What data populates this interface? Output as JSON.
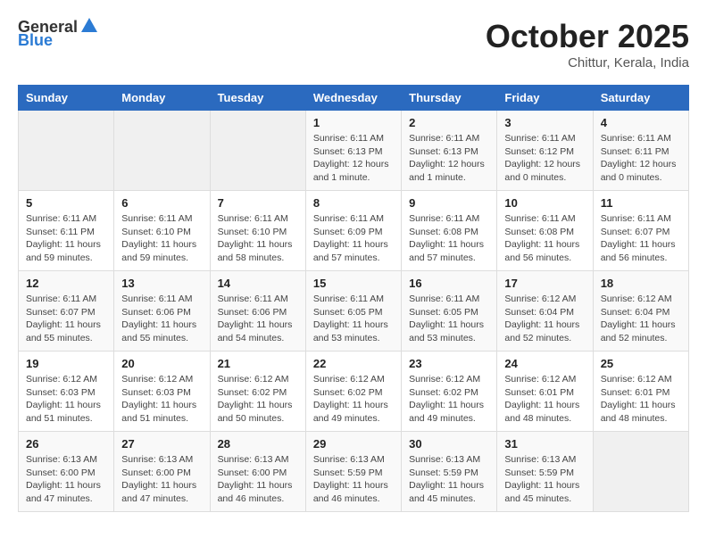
{
  "header": {
    "logo_general": "General",
    "logo_blue": "Blue",
    "month_title": "October 2025",
    "location": "Chittur, Kerala, India"
  },
  "weekdays": [
    "Sunday",
    "Monday",
    "Tuesday",
    "Wednesday",
    "Thursday",
    "Friday",
    "Saturday"
  ],
  "weeks": [
    [
      {
        "day": "",
        "info": ""
      },
      {
        "day": "",
        "info": ""
      },
      {
        "day": "",
        "info": ""
      },
      {
        "day": "1",
        "info": "Sunrise: 6:11 AM\nSunset: 6:13 PM\nDaylight: 12 hours\nand 1 minute."
      },
      {
        "day": "2",
        "info": "Sunrise: 6:11 AM\nSunset: 6:13 PM\nDaylight: 12 hours\nand 1 minute."
      },
      {
        "day": "3",
        "info": "Sunrise: 6:11 AM\nSunset: 6:12 PM\nDaylight: 12 hours\nand 0 minutes."
      },
      {
        "day": "4",
        "info": "Sunrise: 6:11 AM\nSunset: 6:11 PM\nDaylight: 12 hours\nand 0 minutes."
      }
    ],
    [
      {
        "day": "5",
        "info": "Sunrise: 6:11 AM\nSunset: 6:11 PM\nDaylight: 11 hours\nand 59 minutes."
      },
      {
        "day": "6",
        "info": "Sunrise: 6:11 AM\nSunset: 6:10 PM\nDaylight: 11 hours\nand 59 minutes."
      },
      {
        "day": "7",
        "info": "Sunrise: 6:11 AM\nSunset: 6:10 PM\nDaylight: 11 hours\nand 58 minutes."
      },
      {
        "day": "8",
        "info": "Sunrise: 6:11 AM\nSunset: 6:09 PM\nDaylight: 11 hours\nand 57 minutes."
      },
      {
        "day": "9",
        "info": "Sunrise: 6:11 AM\nSunset: 6:08 PM\nDaylight: 11 hours\nand 57 minutes."
      },
      {
        "day": "10",
        "info": "Sunrise: 6:11 AM\nSunset: 6:08 PM\nDaylight: 11 hours\nand 56 minutes."
      },
      {
        "day": "11",
        "info": "Sunrise: 6:11 AM\nSunset: 6:07 PM\nDaylight: 11 hours\nand 56 minutes."
      }
    ],
    [
      {
        "day": "12",
        "info": "Sunrise: 6:11 AM\nSunset: 6:07 PM\nDaylight: 11 hours\nand 55 minutes."
      },
      {
        "day": "13",
        "info": "Sunrise: 6:11 AM\nSunset: 6:06 PM\nDaylight: 11 hours\nand 55 minutes."
      },
      {
        "day": "14",
        "info": "Sunrise: 6:11 AM\nSunset: 6:06 PM\nDaylight: 11 hours\nand 54 minutes."
      },
      {
        "day": "15",
        "info": "Sunrise: 6:11 AM\nSunset: 6:05 PM\nDaylight: 11 hours\nand 53 minutes."
      },
      {
        "day": "16",
        "info": "Sunrise: 6:11 AM\nSunset: 6:05 PM\nDaylight: 11 hours\nand 53 minutes."
      },
      {
        "day": "17",
        "info": "Sunrise: 6:12 AM\nSunset: 6:04 PM\nDaylight: 11 hours\nand 52 minutes."
      },
      {
        "day": "18",
        "info": "Sunrise: 6:12 AM\nSunset: 6:04 PM\nDaylight: 11 hours\nand 52 minutes."
      }
    ],
    [
      {
        "day": "19",
        "info": "Sunrise: 6:12 AM\nSunset: 6:03 PM\nDaylight: 11 hours\nand 51 minutes."
      },
      {
        "day": "20",
        "info": "Sunrise: 6:12 AM\nSunset: 6:03 PM\nDaylight: 11 hours\nand 51 minutes."
      },
      {
        "day": "21",
        "info": "Sunrise: 6:12 AM\nSunset: 6:02 PM\nDaylight: 11 hours\nand 50 minutes."
      },
      {
        "day": "22",
        "info": "Sunrise: 6:12 AM\nSunset: 6:02 PM\nDaylight: 11 hours\nand 49 minutes."
      },
      {
        "day": "23",
        "info": "Sunrise: 6:12 AM\nSunset: 6:02 PM\nDaylight: 11 hours\nand 49 minutes."
      },
      {
        "day": "24",
        "info": "Sunrise: 6:12 AM\nSunset: 6:01 PM\nDaylight: 11 hours\nand 48 minutes."
      },
      {
        "day": "25",
        "info": "Sunrise: 6:12 AM\nSunset: 6:01 PM\nDaylight: 11 hours\nand 48 minutes."
      }
    ],
    [
      {
        "day": "26",
        "info": "Sunrise: 6:13 AM\nSunset: 6:00 PM\nDaylight: 11 hours\nand 47 minutes."
      },
      {
        "day": "27",
        "info": "Sunrise: 6:13 AM\nSunset: 6:00 PM\nDaylight: 11 hours\nand 47 minutes."
      },
      {
        "day": "28",
        "info": "Sunrise: 6:13 AM\nSunset: 6:00 PM\nDaylight: 11 hours\nand 46 minutes."
      },
      {
        "day": "29",
        "info": "Sunrise: 6:13 AM\nSunset: 5:59 PM\nDaylight: 11 hours\nand 46 minutes."
      },
      {
        "day": "30",
        "info": "Sunrise: 6:13 AM\nSunset: 5:59 PM\nDaylight: 11 hours\nand 45 minutes."
      },
      {
        "day": "31",
        "info": "Sunrise: 6:13 AM\nSunset: 5:59 PM\nDaylight: 11 hours\nand 45 minutes."
      },
      {
        "day": "",
        "info": ""
      }
    ]
  ]
}
